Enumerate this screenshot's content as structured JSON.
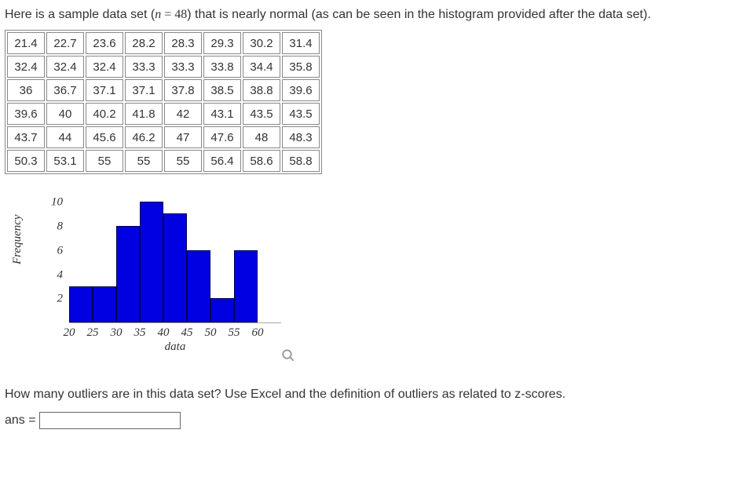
{
  "intro": {
    "part1": "Here is a sample data set (",
    "n_var": "n",
    "eq": " = ",
    "n_val": "48",
    "part2": ") that is nearly normal (as can be seen in the histogram provided after the data set)."
  },
  "table": {
    "rows": [
      [
        "21.4",
        "22.7",
        "23.6",
        "28.2",
        "28.3",
        "29.3",
        "30.2",
        "31.4"
      ],
      [
        "32.4",
        "32.4",
        "32.4",
        "33.3",
        "33.3",
        "33.8",
        "34.4",
        "35.8"
      ],
      [
        "36",
        "36.7",
        "37.1",
        "37.1",
        "37.8",
        "38.5",
        "38.8",
        "39.6"
      ],
      [
        "39.6",
        "40",
        "40.2",
        "41.8",
        "42",
        "43.1",
        "43.5",
        "43.5"
      ],
      [
        "43.7",
        "44",
        "45.6",
        "46.2",
        "47",
        "47.6",
        "48",
        "48.3"
      ],
      [
        "50.3",
        "53.1",
        "55",
        "55",
        "55",
        "56.4",
        "58.6",
        "58.8"
      ]
    ]
  },
  "chart_data": {
    "type": "bar",
    "title": "",
    "xlabel": "data",
    "ylabel": "Frequency",
    "categories": [
      "20-25",
      "25-30",
      "30-35",
      "35-40",
      "40-45",
      "45-50",
      "50-55",
      "55-60"
    ],
    "values": [
      3,
      3,
      8,
      10,
      9,
      6,
      2,
      6
    ],
    "xticks": [
      "20",
      "25",
      "30",
      "35",
      "40",
      "45",
      "50",
      "55",
      "60"
    ],
    "yticks": [
      "2",
      "4",
      "6",
      "8",
      "10"
    ],
    "ylim": [
      0,
      11
    ],
    "xlim": [
      20,
      60
    ]
  },
  "question": "How many outliers are in this data set? Use Excel and the definition of outliers as related to z-scores.",
  "answer": {
    "label": "ans =",
    "value": ""
  }
}
